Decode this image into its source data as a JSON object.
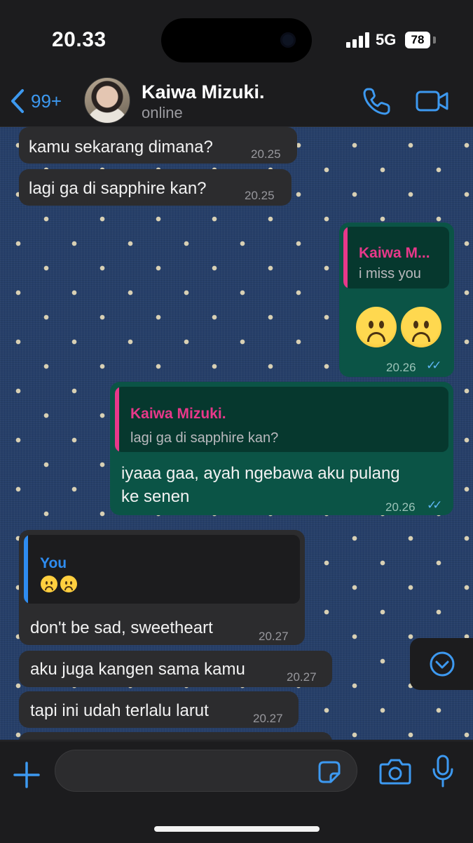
{
  "status_bar": {
    "time": "20.33",
    "network": "5G",
    "battery": "78"
  },
  "header": {
    "back_count": "99+",
    "contact_name": "Kaiwa Mizuki.",
    "contact_status": "online"
  },
  "messages": [
    {
      "text": "kamu sekarang dimana?",
      "time": "20.25"
    },
    {
      "text": "lagi ga di sapphire kan?",
      "time": "20.25"
    },
    {
      "quote_name": "Kaiwa M...",
      "quote_text": "i miss you",
      "emoji": [
        "sad-face",
        "sad-face"
      ],
      "time": "20.26"
    },
    {
      "quote_name": "Kaiwa Mizuki.",
      "quote_text": "lagi ga di sapphire kan?",
      "text_line1": "iyaaa gaa, ayah ngebawa aku pulang",
      "text_line2": "ke senen",
      "time": "20.26"
    },
    {
      "quote_name": "You",
      "quote_emoji": [
        "sad-face",
        "sad-face"
      ],
      "text": "don't be sad, sweetheart",
      "time": "20.27"
    },
    {
      "text": "aku juga kangen sama kamu",
      "time": "20.27"
    },
    {
      "text": "tapi ini udah terlalu larut",
      "time": "20.27"
    }
  ],
  "composer": {
    "placeholder": ""
  },
  "colors": {
    "accent": "#3d99f0",
    "incoming_bubble": "#2c2c2e",
    "outgoing_bubble": "#0b5446",
    "quote_pink": "#e8388a",
    "quote_blue": "#2e8cf0",
    "wallpaper": "#27406a"
  },
  "icons": [
    "chevron-left-icon",
    "phone-icon",
    "video-camera-icon",
    "chevron-down-circle-icon",
    "plus-icon",
    "sticker-icon",
    "camera-icon",
    "microphone-icon",
    "read-ticks-icon"
  ]
}
